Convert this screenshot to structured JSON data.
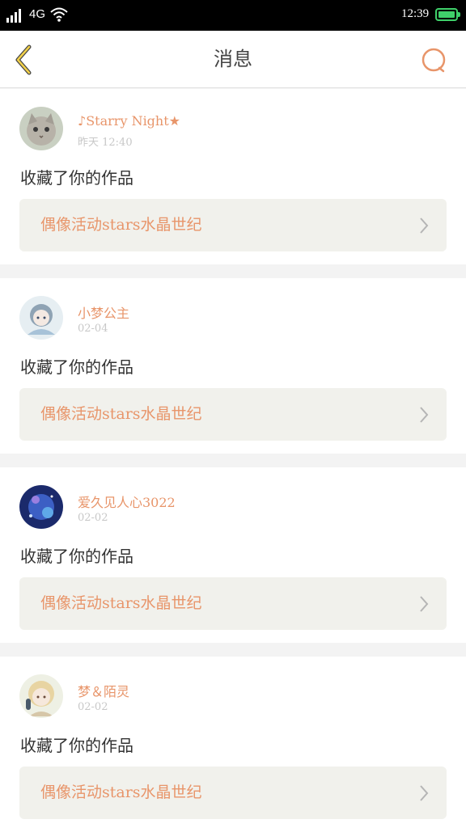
{
  "status_bar": {
    "network": "4G",
    "time": "12:39"
  },
  "header": {
    "title": "消息",
    "back_icon": "back-chevron-icon",
    "search_icon": "search-icon"
  },
  "colors": {
    "accent": "#e8956a",
    "back_arrow": "#f1d04a",
    "card_bg": "#f1f1ec",
    "battery": "#3fd06a"
  },
  "messages": [
    {
      "user": "♪Starry Night★",
      "date": "昨天 12:40",
      "action": "收藏了你的作品",
      "work": "偶像活动stars水晶世纪"
    },
    {
      "user": "小梦公主",
      "date": "02-04",
      "action": "收藏了你的作品",
      "work": "偶像活动stars水晶世纪"
    },
    {
      "user": "爱久见人心3022",
      "date": "02-02",
      "action": "收藏了你的作品",
      "work": "偶像活动stars水晶世纪"
    },
    {
      "user": "梦＆陌灵",
      "date": "02-02",
      "action": "收藏了你的作品",
      "work": "偶像活动stars水晶世纪"
    }
  ]
}
